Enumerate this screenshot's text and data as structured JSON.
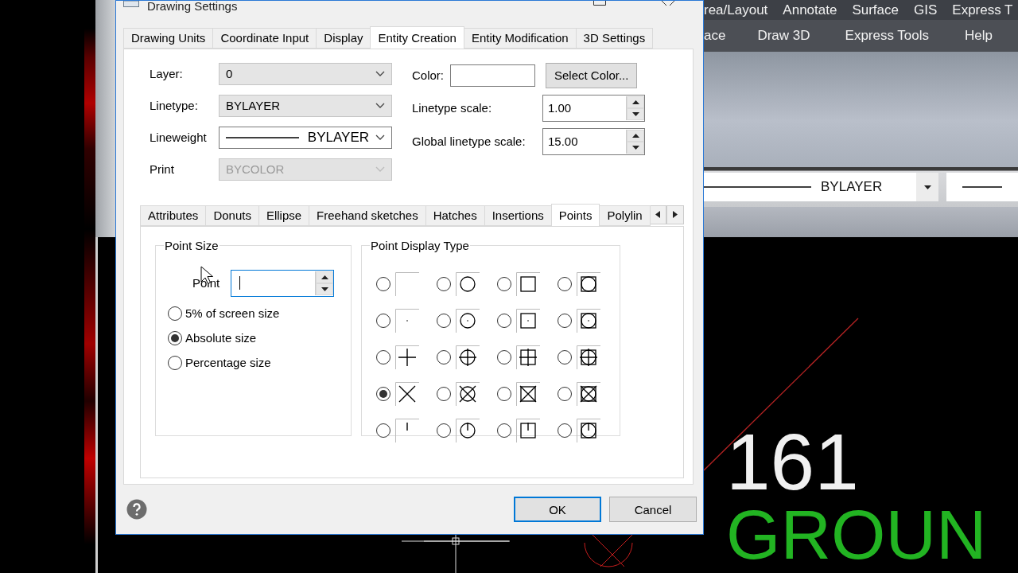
{
  "dialog": {
    "title": "Drawing Settings",
    "tabs": [
      {
        "label": "Drawing Units",
        "selected": false
      },
      {
        "label": "Coordinate Input",
        "selected": false
      },
      {
        "label": "Display",
        "selected": false
      },
      {
        "label": "Entity Creation",
        "selected": true
      },
      {
        "label": "Entity Modification",
        "selected": false
      },
      {
        "label": "3D Settings",
        "selected": false
      }
    ],
    "entity_fields": [
      {
        "label": "Layer:",
        "value": "0",
        "kind": "combo",
        "disabled": false
      },
      {
        "label": "Linetype:",
        "value": "BYLAYER",
        "kind": "combo",
        "disabled": false
      },
      {
        "label": "Lineweight",
        "value": "BYLAYER",
        "kind": "lineweight",
        "disabled": false
      },
      {
        "label": "Print",
        "value": "BYCOLOR",
        "kind": "combo",
        "disabled": true
      }
    ],
    "color": {
      "label": "Color:",
      "button": "Select Color..."
    },
    "scales": [
      {
        "label": "Linetype scale:",
        "value": "1.00"
      },
      {
        "label": "Global linetype scale:",
        "value": "15.00"
      }
    ],
    "sub_tabs": [
      {
        "label": "Attributes",
        "selected": false
      },
      {
        "label": "Donuts",
        "selected": false
      },
      {
        "label": "Ellipse",
        "selected": false
      },
      {
        "label": "Freehand sketches",
        "selected": false
      },
      {
        "label": "Hatches",
        "selected": false
      },
      {
        "label": "Insertions",
        "selected": false
      },
      {
        "label": "Points",
        "selected": true
      },
      {
        "label": "Polylin",
        "selected": false
      }
    ],
    "point_size": {
      "title": "Point Size",
      "label": "Point",
      "options": [
        {
          "label": "5% of screen size",
          "selected": false
        },
        {
          "label": "Absolute size",
          "selected": true
        },
        {
          "label": "Percentage size",
          "selected": false
        }
      ]
    },
    "point_display": {
      "title": "Point Display Type",
      "types": [
        {
          "kind": "blank",
          "selected": false
        },
        {
          "kind": "blankcircle",
          "selected": false
        },
        {
          "kind": "blanksquare",
          "selected": false
        },
        {
          "kind": "blankboth",
          "selected": false
        },
        {
          "kind": "dot",
          "selected": false
        },
        {
          "kind": "dotcircle",
          "selected": false
        },
        {
          "kind": "dotsquare",
          "selected": false
        },
        {
          "kind": "dotboth",
          "selected": false
        },
        {
          "kind": "plus",
          "selected": false
        },
        {
          "kind": "pluscircle",
          "selected": false
        },
        {
          "kind": "plussquare",
          "selected": false
        },
        {
          "kind": "plusboth",
          "selected": false
        },
        {
          "kind": "cross",
          "selected": true
        },
        {
          "kind": "crosscircle",
          "selected": false
        },
        {
          "kind": "crosssquare",
          "selected": false
        },
        {
          "kind": "crossboth",
          "selected": false
        },
        {
          "kind": "tick",
          "selected": false
        },
        {
          "kind": "tickcircle",
          "selected": false
        },
        {
          "kind": "ticksquare",
          "selected": false
        },
        {
          "kind": "tickboth",
          "selected": false
        }
      ]
    },
    "buttons": [
      {
        "label": "OK",
        "default": true
      },
      {
        "label": "Cancel",
        "default": false
      }
    ]
  },
  "menu_rows": [
    [
      "rea/Layout",
      "Annotate",
      "Surface",
      "GIS",
      "Express T"
    ],
    [
      "ace",
      "Draw 3D",
      "Express Tools",
      "Help"
    ]
  ],
  "toolbar_combo": {
    "value": "BYLAYER"
  },
  "canvas_texts": [
    {
      "text": "161",
      "color": "#f0f0f0"
    },
    {
      "text": "GROUN",
      "color": "#22b422"
    }
  ]
}
